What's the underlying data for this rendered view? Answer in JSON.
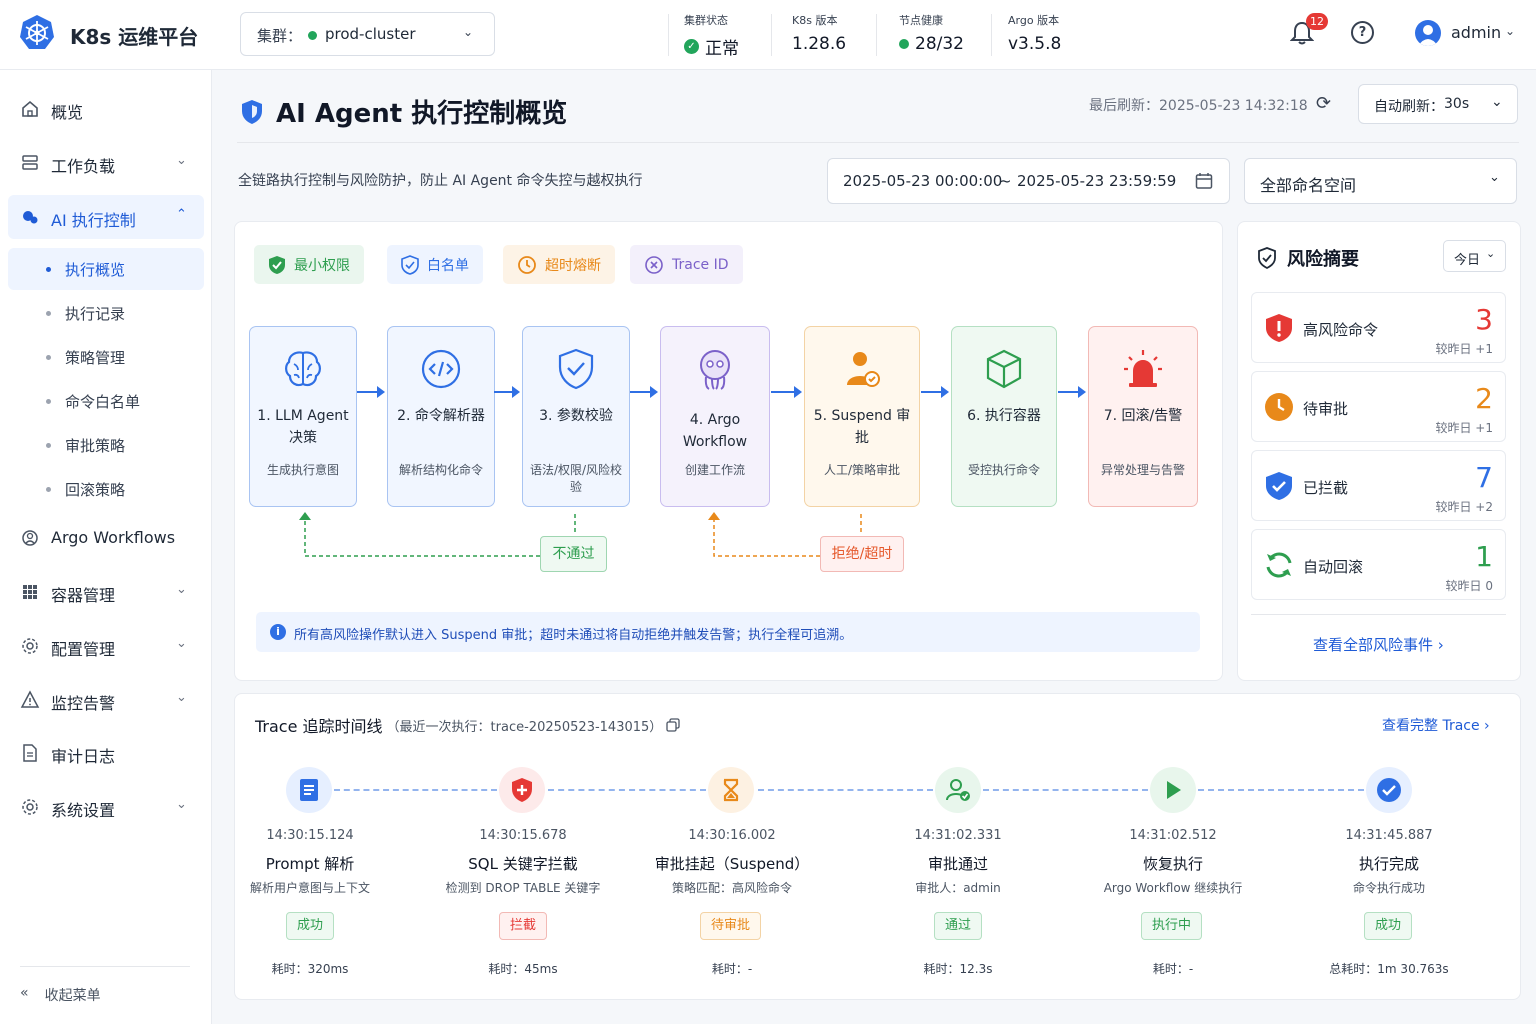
{
  "header": {
    "brand": "K8s 运维平台",
    "cluster_label": "集群：",
    "cluster_value": "prod-cluster",
    "stats": [
      {
        "key": "集群状态",
        "value": "正常"
      },
      {
        "key": "K8s 版本",
        "value": "1.28.6"
      },
      {
        "key": "节点健康",
        "value": "28/32"
      },
      {
        "key": "Argo 版本",
        "value": "v3.5.8"
      }
    ],
    "notification_count": "12",
    "help": "?",
    "user": "admin"
  },
  "sidebar": {
    "items": [
      {
        "label": "概览"
      },
      {
        "label": "工作负载"
      },
      {
        "label": "AI 执行控制"
      },
      {
        "label": "Argo Workflows"
      },
      {
        "label": "容器管理"
      },
      {
        "label": "配置管理"
      },
      {
        "label": "监控告警"
      },
      {
        "label": "审计日志"
      },
      {
        "label": "系统设置"
      }
    ],
    "sub_items": [
      {
        "label": "执行概览"
      },
      {
        "label": "执行记录"
      },
      {
        "label": "策略管理"
      },
      {
        "label": "命令白名单"
      },
      {
        "label": "审批策略"
      },
      {
        "label": "回滚策略"
      }
    ],
    "collapse_label": "收起菜单"
  },
  "page": {
    "title": "AI Agent 执行控制概览",
    "last_refresh_label": "最后刷新：",
    "last_refresh_value": "2025-05-23 14:32:18",
    "auto_refresh_label": "自动刷新：",
    "auto_refresh_value": "30s",
    "subtitle": "全链路执行控制与风险防护，防止 AI Agent 命令失控与越权执行",
    "date_start": "2025-05-23 00:00:00",
    "date_sep": "~",
    "date_end": "2025-05-23 23:59:59",
    "namespace": "全部命名空间"
  },
  "flow": {
    "chips": [
      {
        "label": "最小权限",
        "color": "#2e9e4f"
      },
      {
        "label": "白名单",
        "color": "#2f6fe4"
      },
      {
        "label": "超时熔断",
        "color": "#e8891a"
      },
      {
        "label": "Trace ID",
        "color": "#7b61c9"
      }
    ],
    "steps": [
      {
        "title": "1. LLM Agent 决策",
        "desc": "生成执行意图",
        "icon": "brain-icon"
      },
      {
        "title": "2. 命令解析器",
        "desc": "解析结构化命令",
        "icon": "code-icon"
      },
      {
        "title": "3. 参数校验",
        "desc": "语法/权限/风险校验",
        "icon": "shield-check-icon"
      },
      {
        "title": "4. Argo Workflow",
        "desc": "创建工作流",
        "icon": "argo-icon"
      },
      {
        "title": "5. Suspend 审批",
        "desc": "人工/策略审批",
        "icon": "approver-icon"
      },
      {
        "title": "6. 执行容器",
        "desc": "受控执行命令",
        "icon": "cube-icon"
      },
      {
        "title": "7. 回滚/告警",
        "desc": "异常处理与告警",
        "icon": "alarm-icon"
      }
    ],
    "reject_tag": "不通过",
    "timeout_tag": "拒绝/超时",
    "info": "所有高风险操作默认进入 Suspend 审批；超时未通过将自动拒绝并触发告警；执行全程可追溯。"
  },
  "risk_summary": {
    "title": "风险摘要",
    "period": "今日",
    "items": [
      {
        "label": "高风险命令",
        "value": "3",
        "compare": "较昨日 +1",
        "color": "#e53935"
      },
      {
        "label": "待审批",
        "value": "2",
        "compare": "较昨日 +1",
        "color": "#e8891a"
      },
      {
        "label": "已拦截",
        "value": "7",
        "compare": "较昨日 +2",
        "color": "#2f6fe4"
      },
      {
        "label": "自动回滚",
        "value": "1",
        "compare": "较昨日 0",
        "color": "#2e9e4f"
      }
    ],
    "link": "查看全部风险事件 ›"
  },
  "timeline": {
    "title": "Trace 追踪时间线",
    "trace_note": "（最近一次执行：trace-20250523-143015）",
    "link": "查看完整 Trace ›",
    "events": [
      {
        "time": "14:30:15.124",
        "name": "Prompt 解析",
        "desc": "解析用户意图与上下文",
        "status": "成功",
        "duration": "耗时：320ms"
      },
      {
        "time": "14:30:15.678",
        "name": "SQL 关键字拦截",
        "desc": "检测到 DROP TABLE 关键字",
        "status": "拦截",
        "duration": "耗时：45ms"
      },
      {
        "time": "14:30:16.002",
        "name": "审批挂起（Suspend）",
        "desc": "策略匹配：高风险命令",
        "status": "待审批",
        "duration": "耗时：-"
      },
      {
        "time": "14:31:02.331",
        "name": "审批通过",
        "desc": "审批人：admin",
        "status": "通过",
        "duration": "耗时：12.3s"
      },
      {
        "time": "14:31:02.512",
        "name": "恢复执行",
        "desc": "Argo Workflow 继续执行",
        "status": "执行中",
        "duration": "耗时：-"
      },
      {
        "time": "14:31:45.887",
        "name": "执行完成",
        "desc": "命令执行成功",
        "status": "成功",
        "duration": "总耗时：1m 30.763s"
      }
    ]
  }
}
